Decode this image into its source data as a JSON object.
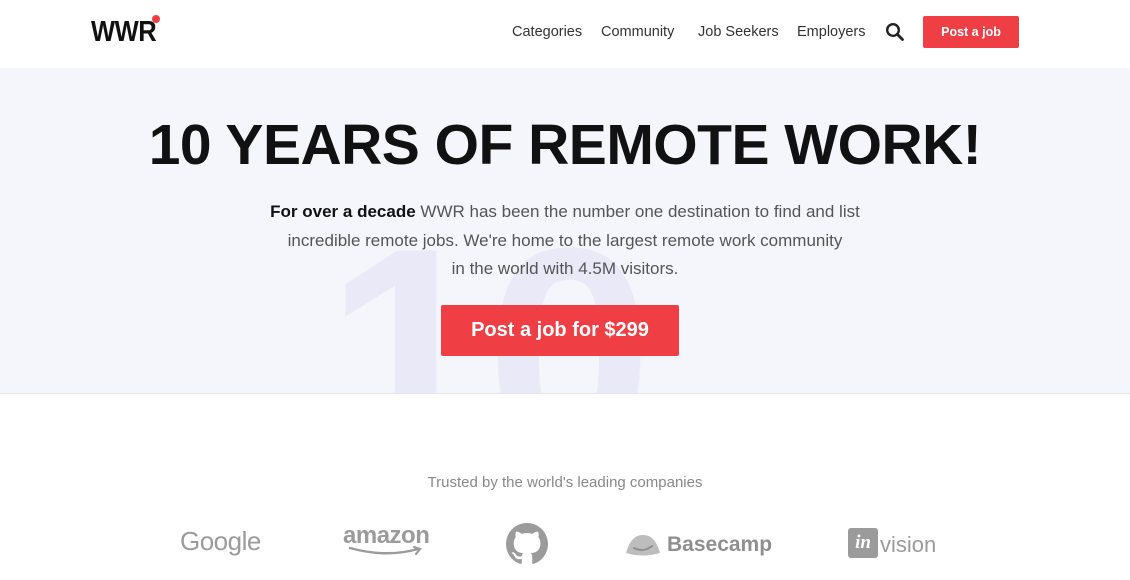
{
  "header": {
    "logo_text": "WWR",
    "nav": [
      "Categories",
      "Community",
      "Job Seekers",
      "Employers"
    ],
    "post_job_label": "Post a job",
    "accent_color": "#ef3f45"
  },
  "hero": {
    "title": "10 YEARS OF REMOTE WORK!",
    "background_number": "10",
    "lead_bold": "For over a decade",
    "lead_rest_line1": " WWR has been the number one destination to find and list",
    "lead_line2": "incredible remote jobs. We're home to the largest remote work community",
    "lead_line3": "in the world with 4.5M visitors.",
    "cta_label": "Post a job for $299"
  },
  "trusted": {
    "heading": "Trusted by the world's leading companies",
    "logos": {
      "google": "Google",
      "amazon": "amazon",
      "github": "github-icon",
      "basecamp": "Basecamp",
      "invision_mark": "in",
      "invision_rest": "vision"
    }
  }
}
